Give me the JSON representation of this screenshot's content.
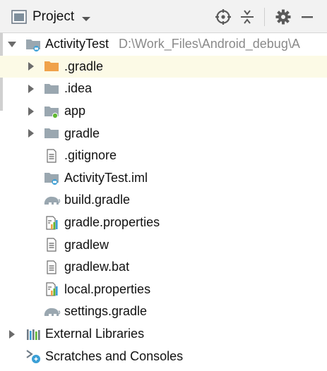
{
  "toolbar": {
    "view_title": "Project",
    "icons": [
      "project-folder-icon",
      "chevron-down-icon",
      "locate-icon",
      "collapse-all-icon",
      "gear-icon",
      "minimize-icon"
    ]
  },
  "tree": {
    "root": {
      "label": "ActivityTest",
      "path": "D:\\Work_Files\\Android_debug\\A"
    },
    "items": [
      {
        "label": ".gradle",
        "icon": "folder-orange-icon"
      },
      {
        "label": ".idea",
        "icon": "folder-icon"
      },
      {
        "label": "app",
        "icon": "module-folder-icon"
      },
      {
        "label": "gradle",
        "icon": "folder-icon"
      },
      {
        "label": ".gitignore",
        "icon": "text-file-icon"
      },
      {
        "label": "ActivityTest.iml",
        "icon": "iml-file-icon"
      },
      {
        "label": "build.gradle",
        "icon": "gradle-elephant-icon"
      },
      {
        "label": "gradle.properties",
        "icon": "properties-file-icon"
      },
      {
        "label": "gradlew",
        "icon": "text-file-icon"
      },
      {
        "label": "gradlew.bat",
        "icon": "text-file-icon"
      },
      {
        "label": "local.properties",
        "icon": "properties-file-icon"
      },
      {
        "label": "settings.gradle",
        "icon": "gradle-elephant-icon"
      }
    ],
    "external_libraries": "External Libraries",
    "scratches": "Scratches and Consoles"
  },
  "colors": {
    "selected_row": "#fcfae6",
    "folder": "#9aa7b0",
    "folder_orange": "#f0a24a",
    "module_dot": "#5fb832",
    "iml_badge": "#3a9fd6"
  }
}
